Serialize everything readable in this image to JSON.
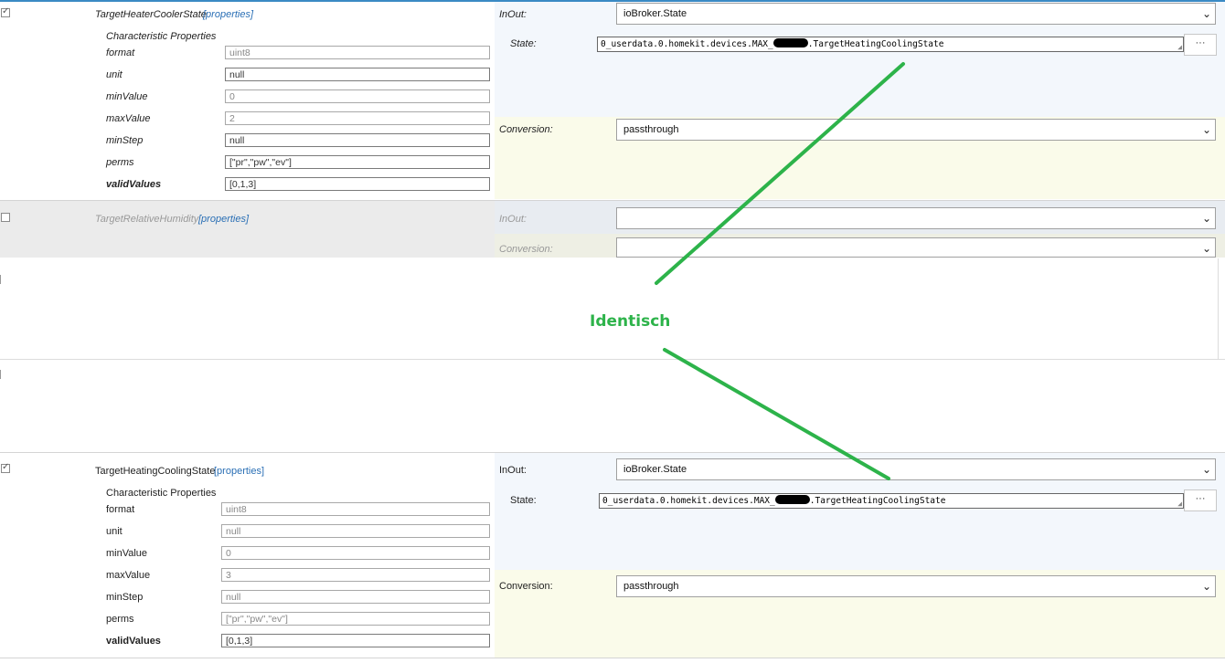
{
  "colors": {
    "link": "#2a6fb5",
    "annotation": "#2db34a",
    "inout_bg": "#f3f7fc",
    "conversion_bg": "#fafbea",
    "disabled_row_bg": "#ebebeb"
  },
  "rows": [
    {
      "name": "TargetHeaterCoolerState",
      "properties_link": "[properties]",
      "checked": true,
      "section_title": "Characteristic Properties",
      "props": [
        {
          "label": "format",
          "value": "uint8"
        },
        {
          "label": "unit",
          "value": "null"
        },
        {
          "label": "minValue",
          "value": "0"
        },
        {
          "label": "maxValue",
          "value": "2"
        },
        {
          "label": "minStep",
          "value": "null"
        },
        {
          "label": "perms",
          "value": "[\"pr\",\"pw\",\"ev\"]"
        },
        {
          "label": "validValues",
          "value": "[0,1,3]"
        }
      ],
      "inout_label": "InOut:",
      "inout_value": "ioBroker.State",
      "state_label": "State:",
      "state_prefix": "0_userdata.0.homekit.devices.MAX_",
      "state_suffix": ".TargetHeatingCoolingState",
      "dots": "···",
      "conversion_label": "Conversion:",
      "conversion_value": "passthrough"
    },
    {
      "name": "TargetRelativeHumidity",
      "properties_link": "[properties]",
      "checked": false,
      "inout_label": "InOut:",
      "inout_value": "",
      "conversion_label": "Conversion:",
      "conversion_value": ""
    },
    {
      "name": "TargetHeatingCoolingState",
      "properties_link": "[properties]",
      "checked": true,
      "section_title": "Characteristic Properties",
      "props": [
        {
          "label": "format",
          "value": "uint8"
        },
        {
          "label": "unit",
          "value": "null"
        },
        {
          "label": "minValue",
          "value": "0"
        },
        {
          "label": "maxValue",
          "value": "3"
        },
        {
          "label": "minStep",
          "value": "null"
        },
        {
          "label": "perms",
          "value": "[\"pr\",\"pw\",\"ev\"]"
        },
        {
          "label": "validValues",
          "value": "[0,1,3]"
        }
      ],
      "inout_label": "InOut:",
      "inout_value": "ioBroker.State",
      "state_label": "State:",
      "state_prefix": "0_userdata.0.homekit.devices.MAX_",
      "state_suffix": ".TargetHeatingCoolingState",
      "dots": "···",
      "conversion_label": "Conversion:",
      "conversion_value": "passthrough"
    }
  ],
  "annotation": {
    "text": "Identisch"
  },
  "icons": {
    "chevron": "chevron-down-icon",
    "checkbox": "checkbox-icon",
    "resize": "resize-grip-icon"
  }
}
